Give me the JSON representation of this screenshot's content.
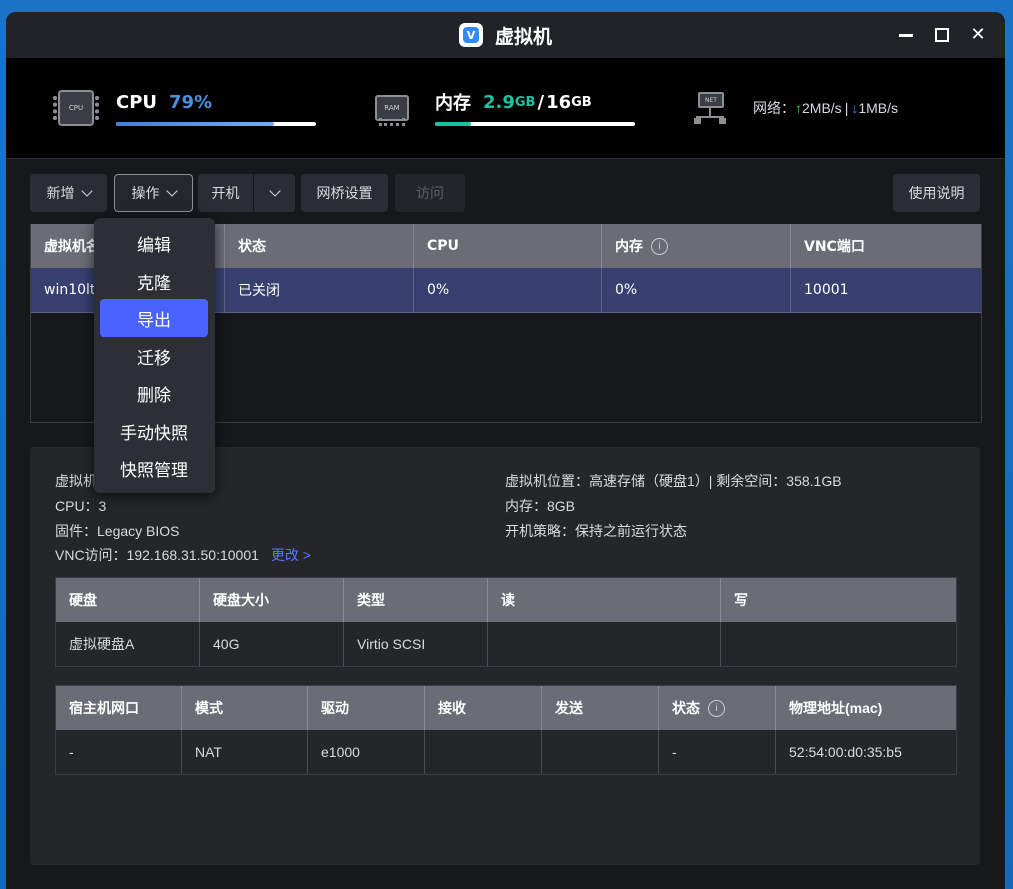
{
  "window": {
    "title": "虚拟机"
  },
  "stats": {
    "cpu": {
      "icon_text": "CPU",
      "label": "CPU",
      "value": "79%",
      "percent": 79,
      "color": "#4a90e2"
    },
    "memory": {
      "icon_text": "RAM",
      "label": "内存",
      "used": "2.9",
      "used_unit": "GB",
      "sep": "/",
      "total": "16",
      "total_unit": "GB",
      "percent": 18,
      "color": "#19c2a0"
    },
    "network": {
      "icon_text": "NET",
      "label": "网络：",
      "up_arrow": "↑",
      "up": "2MB/s",
      "sep": "|",
      "down_arrow": "↓",
      "down": "1MB/s"
    }
  },
  "toolbar": {
    "add": "新增",
    "ops": "操作",
    "power": "开机",
    "bridge": "网桥设置",
    "visit": "访问",
    "help": "使用说明"
  },
  "vm_table": {
    "headers": [
      "虚拟机名",
      "状态",
      "CPU",
      "内存",
      "VNC端口"
    ],
    "rows": [
      {
        "name": "win10ltsc",
        "status": "已关闭",
        "cpu": "0%",
        "mem": "0%",
        "vnc": "10001"
      }
    ]
  },
  "menu": {
    "items": [
      "编辑",
      "克隆",
      "导出",
      "迁移",
      "删除",
      "手动快照",
      "快照管理"
    ],
    "active_index": 2
  },
  "details": {
    "vm_name": "虚拟机",
    "cpu": "CPU：3",
    "firmware": "固件：Legacy BIOS",
    "vnc": "VNC访问：192.168.31.50:10001",
    "vnc_change": "更改 >",
    "location": "虚拟机位置：高速存储（硬盘1）| 剩余空间：358.1GB",
    "memory": "内存：8GB",
    "policy": "开机策略：保持之前运行状态"
  },
  "disk_table": {
    "headers": [
      "硬盘",
      "硬盘大小",
      "类型",
      "读",
      "写"
    ],
    "row": [
      "虚拟硬盘A",
      "40G",
      "Virtio SCSI",
      "",
      ""
    ]
  },
  "net_table": {
    "headers": [
      "宿主机网口",
      "模式",
      "驱动",
      "接收",
      "发送",
      "状态",
      "物理地址(mac)"
    ],
    "row": [
      "-",
      "NAT",
      "e1000",
      "",
      "",
      "-",
      "52:54:00:d0:35:b5"
    ]
  }
}
